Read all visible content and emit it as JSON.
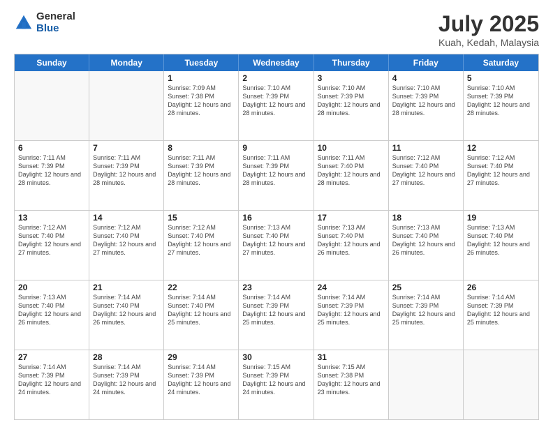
{
  "logo": {
    "general": "General",
    "blue": "Blue"
  },
  "title": "July 2025",
  "subtitle": "Kuah, Kedah, Malaysia",
  "days": [
    "Sunday",
    "Monday",
    "Tuesday",
    "Wednesday",
    "Thursday",
    "Friday",
    "Saturday"
  ],
  "weeks": [
    [
      {
        "num": "",
        "info": ""
      },
      {
        "num": "",
        "info": ""
      },
      {
        "num": "1",
        "info": "Sunrise: 7:09 AM\nSunset: 7:38 PM\nDaylight: 12 hours and 28 minutes."
      },
      {
        "num": "2",
        "info": "Sunrise: 7:10 AM\nSunset: 7:39 PM\nDaylight: 12 hours and 28 minutes."
      },
      {
        "num": "3",
        "info": "Sunrise: 7:10 AM\nSunset: 7:39 PM\nDaylight: 12 hours and 28 minutes."
      },
      {
        "num": "4",
        "info": "Sunrise: 7:10 AM\nSunset: 7:39 PM\nDaylight: 12 hours and 28 minutes."
      },
      {
        "num": "5",
        "info": "Sunrise: 7:10 AM\nSunset: 7:39 PM\nDaylight: 12 hours and 28 minutes."
      }
    ],
    [
      {
        "num": "6",
        "info": "Sunrise: 7:11 AM\nSunset: 7:39 PM\nDaylight: 12 hours and 28 minutes."
      },
      {
        "num": "7",
        "info": "Sunrise: 7:11 AM\nSunset: 7:39 PM\nDaylight: 12 hours and 28 minutes."
      },
      {
        "num": "8",
        "info": "Sunrise: 7:11 AM\nSunset: 7:39 PM\nDaylight: 12 hours and 28 minutes."
      },
      {
        "num": "9",
        "info": "Sunrise: 7:11 AM\nSunset: 7:39 PM\nDaylight: 12 hours and 28 minutes."
      },
      {
        "num": "10",
        "info": "Sunrise: 7:11 AM\nSunset: 7:40 PM\nDaylight: 12 hours and 28 minutes."
      },
      {
        "num": "11",
        "info": "Sunrise: 7:12 AM\nSunset: 7:40 PM\nDaylight: 12 hours and 27 minutes."
      },
      {
        "num": "12",
        "info": "Sunrise: 7:12 AM\nSunset: 7:40 PM\nDaylight: 12 hours and 27 minutes."
      }
    ],
    [
      {
        "num": "13",
        "info": "Sunrise: 7:12 AM\nSunset: 7:40 PM\nDaylight: 12 hours and 27 minutes."
      },
      {
        "num": "14",
        "info": "Sunrise: 7:12 AM\nSunset: 7:40 PM\nDaylight: 12 hours and 27 minutes."
      },
      {
        "num": "15",
        "info": "Sunrise: 7:12 AM\nSunset: 7:40 PM\nDaylight: 12 hours and 27 minutes."
      },
      {
        "num": "16",
        "info": "Sunrise: 7:13 AM\nSunset: 7:40 PM\nDaylight: 12 hours and 27 minutes."
      },
      {
        "num": "17",
        "info": "Sunrise: 7:13 AM\nSunset: 7:40 PM\nDaylight: 12 hours and 26 minutes."
      },
      {
        "num": "18",
        "info": "Sunrise: 7:13 AM\nSunset: 7:40 PM\nDaylight: 12 hours and 26 minutes."
      },
      {
        "num": "19",
        "info": "Sunrise: 7:13 AM\nSunset: 7:40 PM\nDaylight: 12 hours and 26 minutes."
      }
    ],
    [
      {
        "num": "20",
        "info": "Sunrise: 7:13 AM\nSunset: 7:40 PM\nDaylight: 12 hours and 26 minutes."
      },
      {
        "num": "21",
        "info": "Sunrise: 7:14 AM\nSunset: 7:40 PM\nDaylight: 12 hours and 26 minutes."
      },
      {
        "num": "22",
        "info": "Sunrise: 7:14 AM\nSunset: 7:40 PM\nDaylight: 12 hours and 25 minutes."
      },
      {
        "num": "23",
        "info": "Sunrise: 7:14 AM\nSunset: 7:39 PM\nDaylight: 12 hours and 25 minutes."
      },
      {
        "num": "24",
        "info": "Sunrise: 7:14 AM\nSunset: 7:39 PM\nDaylight: 12 hours and 25 minutes."
      },
      {
        "num": "25",
        "info": "Sunrise: 7:14 AM\nSunset: 7:39 PM\nDaylight: 12 hours and 25 minutes."
      },
      {
        "num": "26",
        "info": "Sunrise: 7:14 AM\nSunset: 7:39 PM\nDaylight: 12 hours and 25 minutes."
      }
    ],
    [
      {
        "num": "27",
        "info": "Sunrise: 7:14 AM\nSunset: 7:39 PM\nDaylight: 12 hours and 24 minutes."
      },
      {
        "num": "28",
        "info": "Sunrise: 7:14 AM\nSunset: 7:39 PM\nDaylight: 12 hours and 24 minutes."
      },
      {
        "num": "29",
        "info": "Sunrise: 7:14 AM\nSunset: 7:39 PM\nDaylight: 12 hours and 24 minutes."
      },
      {
        "num": "30",
        "info": "Sunrise: 7:15 AM\nSunset: 7:39 PM\nDaylight: 12 hours and 24 minutes."
      },
      {
        "num": "31",
        "info": "Sunrise: 7:15 AM\nSunset: 7:38 PM\nDaylight: 12 hours and 23 minutes."
      },
      {
        "num": "",
        "info": ""
      },
      {
        "num": "",
        "info": ""
      }
    ]
  ]
}
